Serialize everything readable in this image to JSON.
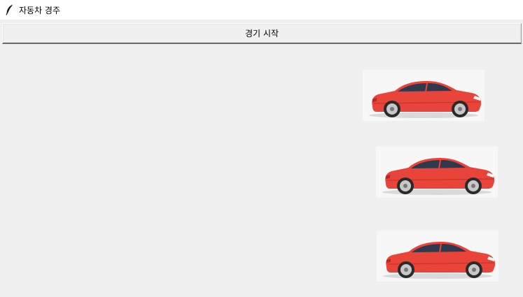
{
  "window": {
    "title": "자동차 경주",
    "icon": "feather-icon"
  },
  "toolbar": {
    "start_label": "경기 시작"
  },
  "race": {
    "cars": [
      {
        "name": "car-1",
        "color": "#e8443a"
      },
      {
        "name": "car-2",
        "color": "#e8443a"
      },
      {
        "name": "car-3",
        "color": "#e8443a"
      }
    ]
  }
}
